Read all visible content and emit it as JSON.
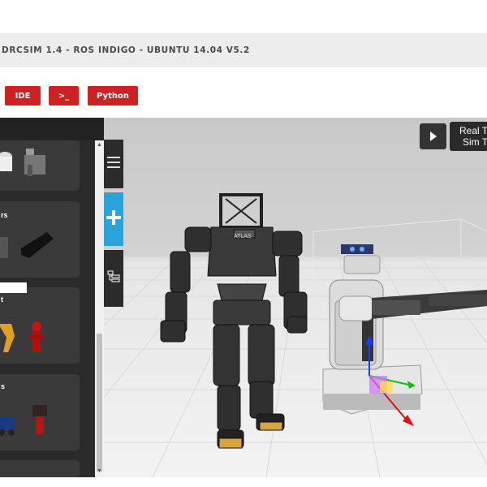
{
  "window": {
    "title": "DRCSIM 1.4 - ROS INDIGO - UBUNTU 14.04 V5.2"
  },
  "toolbar": {
    "ide_label": "IDE",
    "terminal_label": ">_",
    "python_label": "Python"
  },
  "palette": {
    "cards": [
      {
        "label": ""
      },
      {
        "label": "rs"
      },
      {
        "label": "t"
      },
      {
        "label": "s"
      }
    ],
    "search_placeholder": ""
  },
  "side_tabs": [
    {
      "name": "menu",
      "icon": "hamburger-icon"
    },
    {
      "name": "insert",
      "icon": "plus-icon"
    },
    {
      "name": "tree",
      "icon": "tree-icon"
    }
  ],
  "sim_controls": {
    "play_icon": "play-icon",
    "real_time_label": "Real T",
    "sim_time_label": "Sim T"
  },
  "scene": {
    "robot_label": "ATLAS"
  },
  "colors": {
    "accent": "#cc2222",
    "panel": "#2b2b2b",
    "insert_tab": "#2aa3d8"
  }
}
